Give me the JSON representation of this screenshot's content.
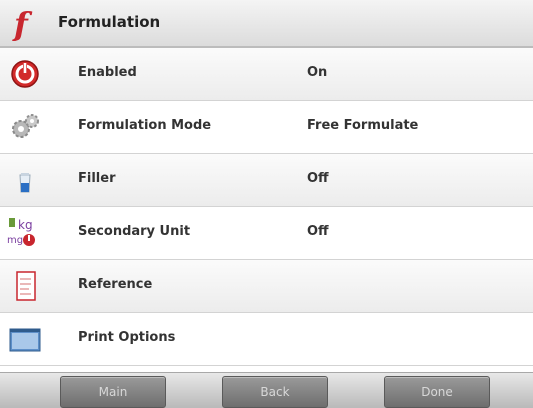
{
  "header": {
    "title": "Formulation",
    "icon": "function-f-icon"
  },
  "rows": [
    {
      "label": "Enabled",
      "value": "On",
      "icon": "power-icon"
    },
    {
      "label": "Formulation Mode",
      "value": "Free Formulate",
      "icon": "gears-icon"
    },
    {
      "label": "Filler",
      "value": "Off",
      "icon": "filler-icon"
    },
    {
      "label": "Secondary Unit",
      "value": "Off",
      "icon": "unit-kg-icon",
      "icon_text_top": "kg",
      "icon_text_bottom": "mg"
    },
    {
      "label": "Reference",
      "value": "",
      "icon": "reference-document-icon"
    },
    {
      "label": "Print Options",
      "value": "",
      "icon": "print-options-icon"
    }
  ],
  "footer": {
    "main_label": "Main",
    "back_label": "Back",
    "done_label": "Done"
  },
  "colors": {
    "accent_red": "#c8262e",
    "button_gray": "#7c7c7c"
  }
}
